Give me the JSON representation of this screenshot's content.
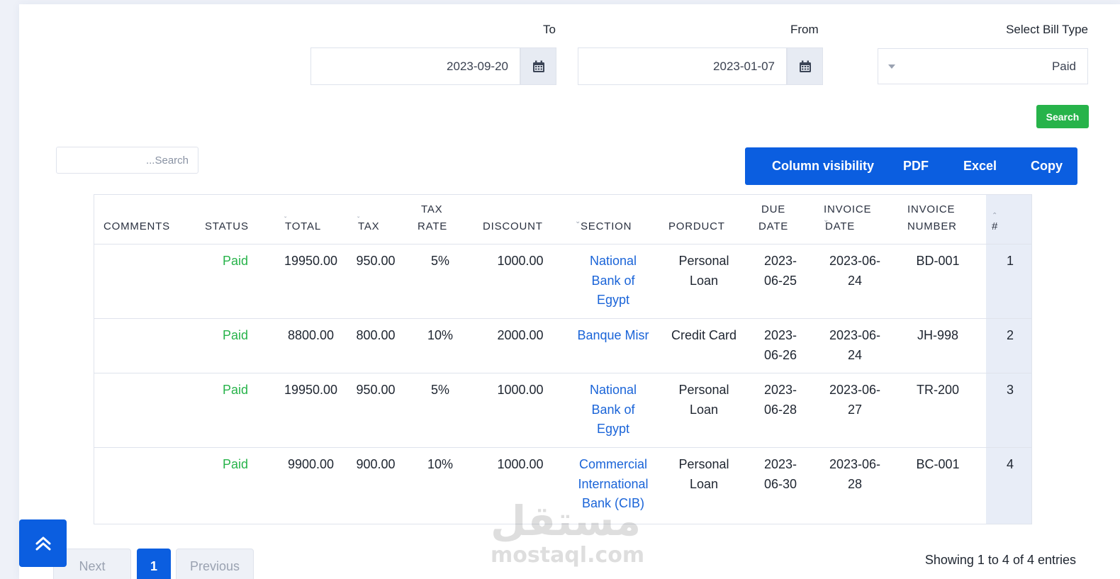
{
  "filters": {
    "bill_type_label": "Select Bill Type",
    "bill_type_value": "Paid",
    "from_label": "From",
    "from_value": "2023-01-07",
    "to_label": "To",
    "to_value": "2023-09-20",
    "search_button": "Search"
  },
  "table_tools": {
    "search_placeholder": "...Search",
    "buttons": [
      "Column visibility",
      "PDF",
      "Excel",
      "Copy"
    ]
  },
  "table": {
    "headers": {
      "num": "#",
      "invoice_number": [
        "INVOICE",
        "NUMBER"
      ],
      "invoice_date": [
        "INVOICE",
        "DATE"
      ],
      "due_date": [
        "DUE",
        "DATE"
      ],
      "product": "PORDUCT",
      "section": "SECTION",
      "discount": "DISCOUNT",
      "tax_rate": [
        "TAX",
        "RATE"
      ],
      "tax": "TAX",
      "total": "TOTAL",
      "status": "STATUS",
      "comments": "COMMENTS"
    },
    "rows": [
      {
        "num": "1",
        "invoice_number": "BD-001",
        "invoice_date": [
          "2023-06-",
          "24"
        ],
        "due_date": [
          "2023-",
          "06-25"
        ],
        "product": [
          "Personal",
          "Loan"
        ],
        "section": [
          "National",
          "Bank of",
          "Egypt"
        ],
        "discount": "1000.00",
        "tax_rate": "5%",
        "tax": "950.00",
        "total": "19950.00",
        "status": "Paid",
        "comments": ""
      },
      {
        "num": "2",
        "invoice_number": "JH-998",
        "invoice_date": [
          "2023-06-",
          "24"
        ],
        "due_date": [
          "2023-",
          "06-26"
        ],
        "product": [
          "Credit Card"
        ],
        "section": [
          "Banque Misr"
        ],
        "discount": "2000.00",
        "tax_rate": "10%",
        "tax": "800.00",
        "total": "8800.00",
        "status": "Paid",
        "comments": ""
      },
      {
        "num": "3",
        "invoice_number": "TR-200",
        "invoice_date": [
          "2023-06-",
          "27"
        ],
        "due_date": [
          "2023-",
          "06-28"
        ],
        "product": [
          "Personal",
          "Loan"
        ],
        "section": [
          "National",
          "Bank of",
          "Egypt"
        ],
        "discount": "1000.00",
        "tax_rate": "5%",
        "tax": "950.00",
        "total": "19950.00",
        "status": "Paid",
        "comments": ""
      },
      {
        "num": "4",
        "invoice_number": "BC-001",
        "invoice_date": [
          "2023-06-",
          "28"
        ],
        "due_date": [
          "2023-",
          "06-30"
        ],
        "product": [
          "Personal",
          "Loan"
        ],
        "section": [
          "Commercial",
          "International",
          "Bank (CIB)"
        ],
        "discount": "1000.00",
        "tax_rate": "10%",
        "tax": "900.00",
        "total": "9900.00",
        "status": "Paid",
        "comments": ""
      }
    ]
  },
  "pagination": {
    "next": "Next",
    "current": "1",
    "previous": "Previous",
    "info": "Showing 1 to 4 of 4 entries"
  },
  "watermark": {
    "arabic": "مستقل",
    "latin": "mostaql.com"
  },
  "colors": {
    "accent": "#0b5ee0",
    "success": "#27b34a",
    "link": "#1a64d8"
  },
  "icons": {
    "calendar": "calendar-icon",
    "scroll_top": "double-chevron-up-icon"
  }
}
